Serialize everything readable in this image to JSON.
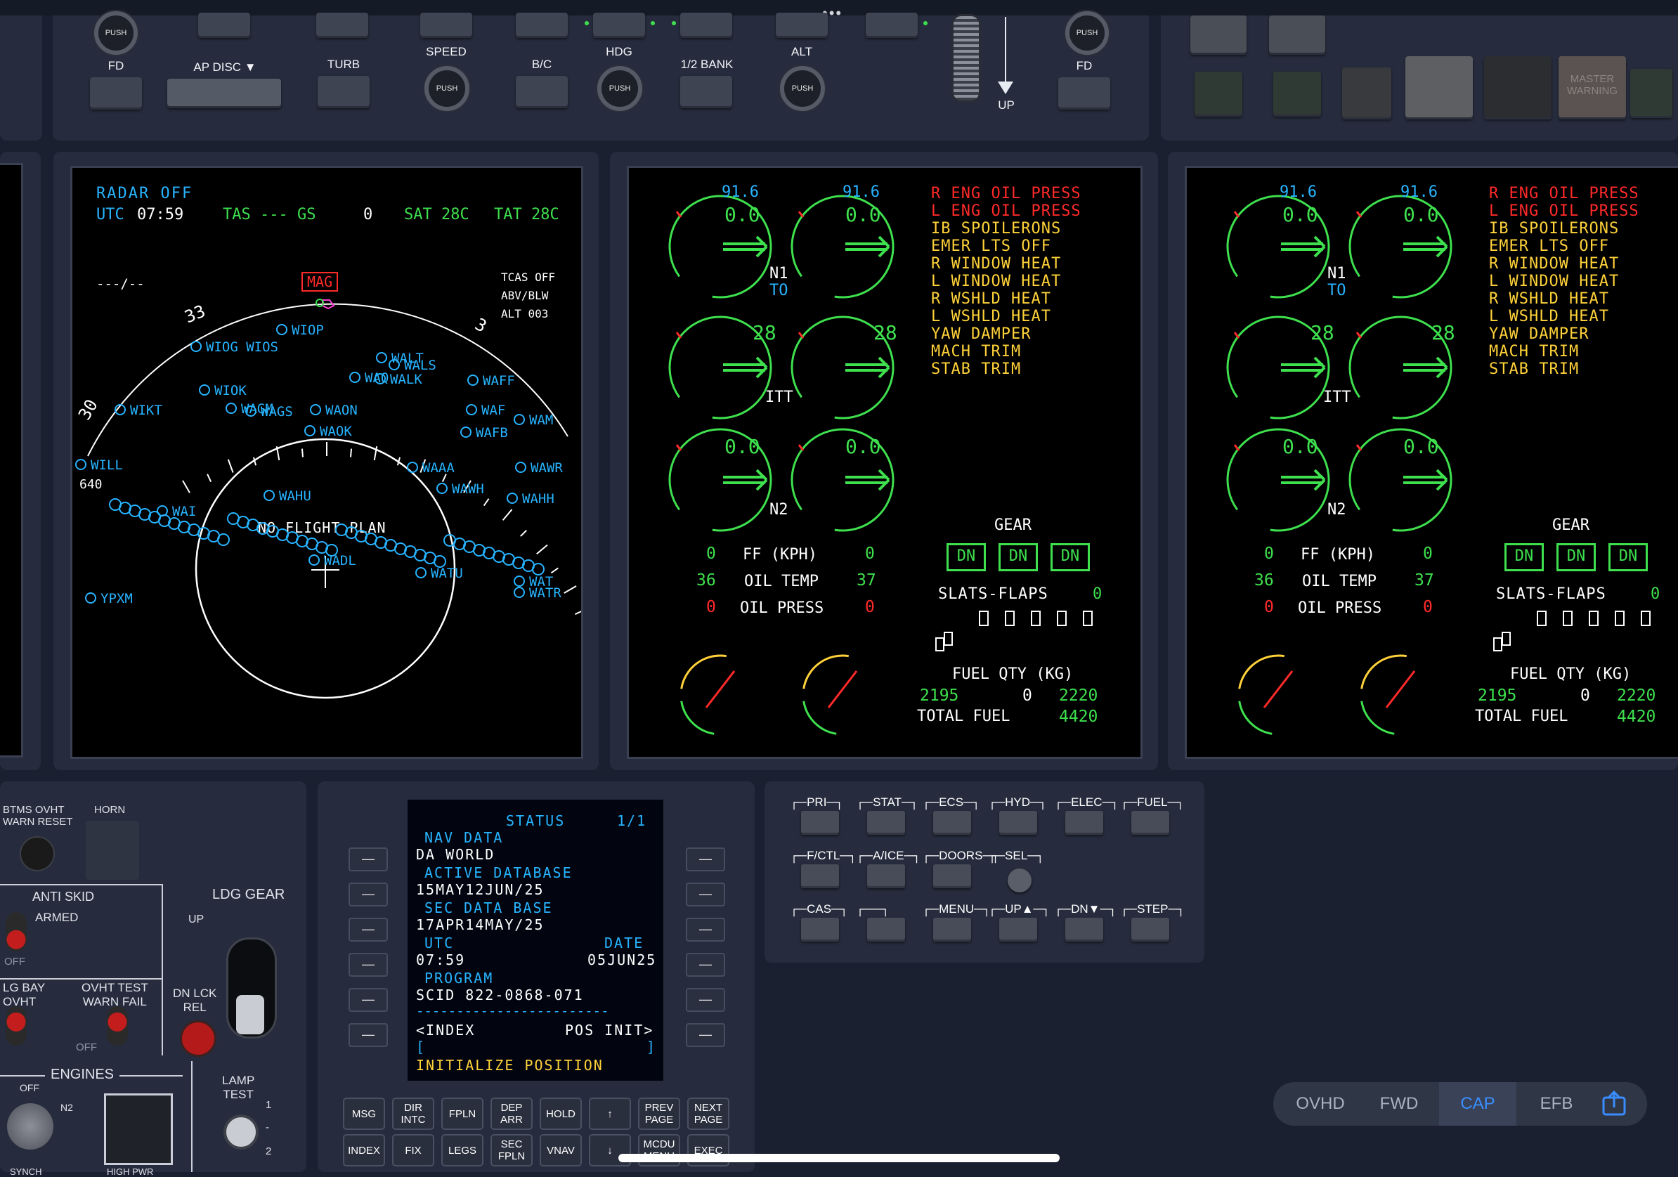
{
  "glareshield": {
    "fd_left": {
      "push": "PUSH",
      "label": "FD"
    },
    "ap_disc": "AP DISC ▼",
    "turb": "TURB",
    "speed": {
      "label": "SPEED",
      "push": "PUSH"
    },
    "bc": "B/C",
    "hdg": {
      "label": "HDG",
      "push": "PUSH"
    },
    "half_bank": "1/2 BANK",
    "alt": {
      "label": "ALT",
      "push": "PUSH"
    },
    "up": "UP",
    "fd_right": {
      "push": "PUSH",
      "label": "FD"
    },
    "master_warning": "MASTER WARNING"
  },
  "mfd": {
    "radar": "RADAR OFF",
    "utc_label": "UTC",
    "utc_value": "07:59",
    "tas": "TAS --- GS",
    "gs_value": "0",
    "sat": "SAT 28C",
    "tat": "TAT 28C",
    "dashes": "---/--",
    "mag": "MAG",
    "tcas": [
      "TCAS OFF",
      "ABV/BLW",
      "ALT 003"
    ],
    "hdg_33": "33",
    "hdg_30": "30",
    "hdg_3": "3",
    "range_640": "640",
    "no_flight_plan": "NO FLIGHT PLAN",
    "waypoints": [
      {
        "label": "WIOP"
      },
      {
        "label": "WIOG WIOS"
      },
      {
        "label": "WALT"
      },
      {
        "label": "WALS"
      },
      {
        "label": "WAQ"
      },
      {
        "label": "WALK"
      },
      {
        "label": "WAFF"
      },
      {
        "label": "WIOK"
      },
      {
        "label": "WIKT"
      },
      {
        "label": "WAGM"
      },
      {
        "label": "WAGS"
      },
      {
        "label": "WAON"
      },
      {
        "label": "WAF"
      },
      {
        "label": "WAM"
      },
      {
        "label": "WAOK"
      },
      {
        "label": "WAFB"
      },
      {
        "label": "WILL"
      },
      {
        "label": "WAHU"
      },
      {
        "label": "WAAA"
      },
      {
        "label": "WAWR"
      },
      {
        "label": "WAWH"
      },
      {
        "label": "WADL"
      },
      {
        "label": "WATU"
      },
      {
        "label": "WAT"
      },
      {
        "label": "WATR"
      },
      {
        "label": "YPXM"
      },
      {
        "label": "WAI"
      },
      {
        "label": "WAHH"
      }
    ]
  },
  "eicas": {
    "n1_left_top": "91.6",
    "n1_left": "0.0",
    "n1_right_top": "91.6",
    "n1_right": "0.0",
    "n1_label": "N1",
    "to_label": "TO",
    "itt_left": "28",
    "itt_right": "28",
    "itt_label": "ITT",
    "n2_left": "0.0",
    "n2_right": "0.0",
    "n2_label": "N2",
    "ff_left": "0",
    "ff_label": "FF (KPH)",
    "ff_right": "0",
    "oil_temp_left": "36",
    "oil_temp_label": "OIL TEMP",
    "oil_temp_right": "37",
    "oil_press_left": "0",
    "oil_press_label": "OIL PRESS",
    "oil_press_right": "0",
    "cas_red": [
      "R ENG OIL PRESS",
      "L ENG OIL PRESS"
    ],
    "cas_yellow": [
      "IB SPOILERONS",
      "EMER LTS OFF",
      "R WINDOW HEAT",
      "L WINDOW HEAT",
      "R WSHLD HEAT",
      "L WSHLD HEAT",
      "YAW DAMPER",
      "MACH TRIM",
      "STAB TRIM"
    ],
    "gear_label": "GEAR",
    "gear": [
      "DN",
      "DN",
      "DN"
    ],
    "slats_flaps_label": "SLATS-FLAPS",
    "slats_flaps_value": "0",
    "fuel_qty_label": "FUEL QTY (KG)",
    "fuel_left": "2195",
    "fuel_center": "0",
    "fuel_right": "2220",
    "total_fuel_label": "TOTAL FUEL",
    "total_fuel": "4420"
  },
  "pedestal": {
    "btms_reset": "BTMS OVHT\nWARN RESET",
    "horn": "HORN",
    "anti_skid": "ANTI SKID",
    "armed": "ARMED",
    "off": "OFF",
    "ldg_gear": "LDG GEAR",
    "up": "UP",
    "lg_bay": "LG BAY\nOVHT",
    "ovht_test": "OVHT TEST\nWARN FAIL",
    "off2": "OFF",
    "dn_lck_rel": "DN LCK\nREL",
    "engines": "ENGINES",
    "eng_off": "OFF",
    "n2": "N2",
    "lamp_test": "LAMP\nTEST",
    "lamp_1": "1",
    "lamp_dash": "-",
    "lamp_2": "2",
    "synch": "SYNCH",
    "high_pwr": "HIGH PWR"
  },
  "cdu": {
    "title": "STATUS",
    "page": "1/1",
    "nav_data": "NAV DATA",
    "world": "DA WORLD",
    "active_db": "ACTIVE DATABASE",
    "active_db_value": "15MAY12JUN/25",
    "sec_db": "SEC DATA BASE",
    "sec_db_value": "17APR14MAY/25",
    "utc": "UTC",
    "date": "DATE",
    "utc_value": "07:59",
    "date_value": "05JUN25",
    "program": "PROGRAM",
    "scid": "SCID 822-0868-071",
    "divider": "------------------------",
    "index": "<INDEX",
    "pos_init": "POS INIT>",
    "bracket_l": "[",
    "bracket_r": "]",
    "initialize": "INITIALIZE POSITION",
    "lsk": "—",
    "keys_row1": [
      "MSG",
      "DIR\nINTC",
      "FPLN",
      "DEP\nARR",
      "HOLD",
      "↑",
      "PREV\nPAGE",
      "NEXT\nPAGE"
    ],
    "keys_row2": [
      "INDEX",
      "FIX",
      "LEGS",
      "SEC\nFPLN",
      "VNAV",
      "↓",
      "MCDU\nMENU",
      "EXEC"
    ]
  },
  "ecp": {
    "row1": [
      "PRI",
      "STAT",
      "ECS",
      "HYD",
      "ELEC",
      "FUEL"
    ],
    "row2": [
      "F/CTL",
      "A/ICE",
      "DOORS",
      "SEL"
    ],
    "row3": [
      "CAS",
      "",
      "MENU",
      "UP▲",
      "DN▼",
      "STEP"
    ]
  },
  "nav": {
    "tabs": [
      "OVHD",
      "FWD",
      "CAP",
      "EFB"
    ],
    "active": "CAP",
    "active_color": "#3a8dff"
  },
  "colors": {
    "bg": "#1b2030",
    "panel": "#262c3d",
    "cyan": "#27b4ff",
    "green": "#3ee04e",
    "red": "#ff2a2a",
    "yellow": "#ffd23a",
    "magenta": "#ff3bd4"
  }
}
